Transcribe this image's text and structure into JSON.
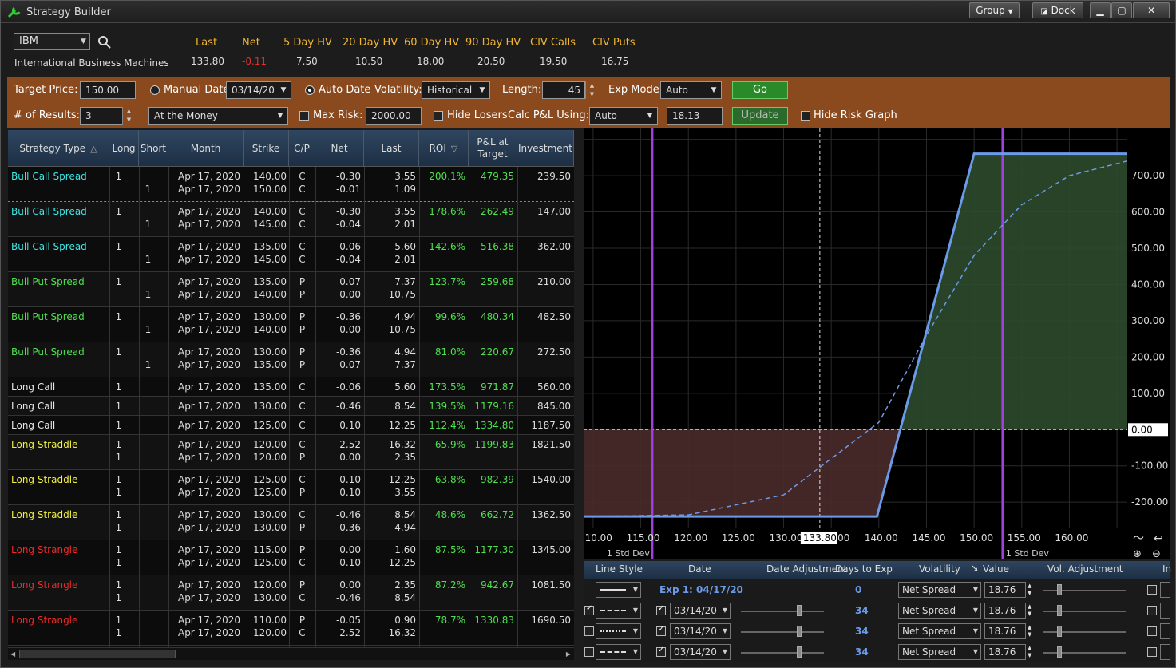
{
  "window": {
    "title": "Strategy Builder",
    "group_label": "Group",
    "dock_label": "Dock"
  },
  "quote": {
    "symbol": "IBM",
    "company": "International Business Machines",
    "headers": [
      "Last",
      "Net",
      "5 Day HV",
      "20 Day HV",
      "60 Day HV",
      "90 Day HV",
      "CIV Calls",
      "CIV Puts"
    ],
    "values": [
      "133.80",
      "-0.11",
      "7.50",
      "10.50",
      "18.00",
      "20.50",
      "19.50",
      "16.75"
    ]
  },
  "controls": {
    "target_price_label": "Target Price:",
    "target_price": "150.00",
    "manual_date_label": "Manual Date",
    "manual_date": "03/14/20",
    "auto_date_label": "Auto Date",
    "volatility_label": "Volatility:",
    "volatility": "Historical",
    "length_label": "Length:",
    "length": "45",
    "exp_mode_label": "Exp Mode:",
    "exp_mode": "Auto",
    "go_label": "Go",
    "results_label": "# of Results:",
    "results": "3",
    "moneyness": "At the Money",
    "max_risk_label": "Max Risk:",
    "max_risk": "2000.00",
    "hide_losers_label": "Hide Losers",
    "calc_pl_label": "Calc P&L Using:",
    "calc_pl": "Auto",
    "calc_value": "18.13",
    "update_label": "Update",
    "hide_risk_label": "Hide Risk Graph"
  },
  "table": {
    "headers": [
      "Strategy Type",
      "Long",
      "Short",
      "Month",
      "Strike",
      "C/P",
      "Net",
      "Last",
      "ROI",
      "P&L at Target",
      "Investment"
    ],
    "rows": [
      {
        "type": "Bull Call Spread",
        "color": "#3ee6e6",
        "legs": [
          [
            "1",
            "",
            "Apr 17, 2020",
            "140.00",
            "C",
            "-0.30",
            "3.55"
          ],
          [
            "",
            "1",
            "Apr 17, 2020",
            "150.00",
            "C",
            "-0.01",
            "1.09"
          ]
        ],
        "roi": "200.1%",
        "pl": "479.35",
        "inv": "239.50"
      },
      {
        "type": "Bull Call Spread",
        "color": "#3ee6e6",
        "legs": [
          [
            "1",
            "",
            "Apr 17, 2020",
            "140.00",
            "C",
            "-0.30",
            "3.55"
          ],
          [
            "",
            "1",
            "Apr 17, 2020",
            "145.00",
            "C",
            "-0.04",
            "2.01"
          ]
        ],
        "roi": "178.6%",
        "pl": "262.49",
        "inv": "147.00"
      },
      {
        "type": "Bull Call Spread",
        "color": "#3ee6e6",
        "legs": [
          [
            "1",
            "",
            "Apr 17, 2020",
            "135.00",
            "C",
            "-0.06",
            "5.60"
          ],
          [
            "",
            "1",
            "Apr 17, 2020",
            "145.00",
            "C",
            "-0.04",
            "2.01"
          ]
        ],
        "roi": "142.6%",
        "pl": "516.38",
        "inv": "362.00"
      },
      {
        "type": "Bull Put Spread",
        "color": "#4ee04e",
        "legs": [
          [
            "1",
            "",
            "Apr 17, 2020",
            "135.00",
            "P",
            "0.07",
            "7.37"
          ],
          [
            "",
            "1",
            "Apr 17, 2020",
            "140.00",
            "P",
            "0.00",
            "10.75"
          ]
        ],
        "roi": "123.7%",
        "pl": "259.68",
        "inv": "210.00"
      },
      {
        "type": "Bull Put Spread",
        "color": "#4ee04e",
        "legs": [
          [
            "1",
            "",
            "Apr 17, 2020",
            "130.00",
            "P",
            "-0.36",
            "4.94"
          ],
          [
            "",
            "1",
            "Apr 17, 2020",
            "140.00",
            "P",
            "0.00",
            "10.75"
          ]
        ],
        "roi": "99.6%",
        "pl": "480.34",
        "inv": "482.50"
      },
      {
        "type": "Bull Put Spread",
        "color": "#4ee04e",
        "legs": [
          [
            "1",
            "",
            "Apr 17, 2020",
            "130.00",
            "P",
            "-0.36",
            "4.94"
          ],
          [
            "",
            "1",
            "Apr 17, 2020",
            "135.00",
            "P",
            "0.07",
            "7.37"
          ]
        ],
        "roi": "81.0%",
        "pl": "220.67",
        "inv": "272.50"
      },
      {
        "type": "Long Call",
        "color": "#e8e8e8",
        "legs": [
          [
            "1",
            "",
            "Apr 17, 2020",
            "135.00",
            "C",
            "-0.06",
            "5.60"
          ]
        ],
        "roi": "173.5%",
        "pl": "971.87",
        "inv": "560.00"
      },
      {
        "type": "Long Call",
        "color": "#e8e8e8",
        "legs": [
          [
            "1",
            "",
            "Apr 17, 2020",
            "130.00",
            "C",
            "-0.46",
            "8.54"
          ]
        ],
        "roi": "139.5%",
        "pl": "1179.16",
        "inv": "845.00"
      },
      {
        "type": "Long Call",
        "color": "#e8e8e8",
        "legs": [
          [
            "1",
            "",
            "Apr 17, 2020",
            "125.00",
            "C",
            "0.10",
            "12.25"
          ]
        ],
        "roi": "112.4%",
        "pl": "1334.80",
        "inv": "1187.50"
      },
      {
        "type": "Long Straddle",
        "color": "#f0f040",
        "legs": [
          [
            "1",
            "",
            "Apr 17, 2020",
            "120.00",
            "C",
            "2.52",
            "16.32"
          ],
          [
            "1",
            "",
            "Apr 17, 2020",
            "120.00",
            "P",
            "0.00",
            "2.35"
          ]
        ],
        "roi": "65.9%",
        "pl": "1199.83",
        "inv": "1821.50"
      },
      {
        "type": "Long Straddle",
        "color": "#f0f040",
        "legs": [
          [
            "1",
            "",
            "Apr 17, 2020",
            "125.00",
            "C",
            "0.10",
            "12.25"
          ],
          [
            "1",
            "",
            "Apr 17, 2020",
            "125.00",
            "P",
            "0.10",
            "3.55"
          ]
        ],
        "roi": "63.8%",
        "pl": "982.39",
        "inv": "1540.00"
      },
      {
        "type": "Long Straddle",
        "color": "#f0f040",
        "legs": [
          [
            "1",
            "",
            "Apr 17, 2020",
            "130.00",
            "C",
            "-0.46",
            "8.54"
          ],
          [
            "1",
            "",
            "Apr 17, 2020",
            "130.00",
            "P",
            "-0.36",
            "4.94"
          ]
        ],
        "roi": "48.6%",
        "pl": "662.72",
        "inv": "1362.50"
      },
      {
        "type": "Long Strangle",
        "color": "#ee2a2a",
        "legs": [
          [
            "1",
            "",
            "Apr 17, 2020",
            "115.00",
            "P",
            "0.00",
            "1.60"
          ],
          [
            "1",
            "",
            "Apr 17, 2020",
            "125.00",
            "C",
            "0.10",
            "12.25"
          ]
        ],
        "roi": "87.5%",
        "pl": "1177.30",
        "inv": "1345.00"
      },
      {
        "type": "Long Strangle",
        "color": "#ee2a2a",
        "legs": [
          [
            "1",
            "",
            "Apr 17, 2020",
            "120.00",
            "P",
            "0.00",
            "2.35"
          ],
          [
            "1",
            "",
            "Apr 17, 2020",
            "130.00",
            "C",
            "-0.46",
            "8.54"
          ]
        ],
        "roi": "87.2%",
        "pl": "942.67",
        "inv": "1081.50"
      },
      {
        "type": "Long Strangle",
        "color": "#ee2a2a",
        "legs": [
          [
            "1",
            "",
            "Apr 17, 2020",
            "110.00",
            "P",
            "-0.05",
            "0.90"
          ],
          [
            "1",
            "",
            "Apr 17, 2020",
            "120.00",
            "C",
            "2.52",
            "16.32"
          ]
        ],
        "roi": "78.7%",
        "pl": "1330.83",
        "inv": "1690.50"
      }
    ]
  },
  "chart_data": {
    "type": "line",
    "x_ticks": [
      "110.00",
      "115.00",
      "120.00",
      "125.00",
      "130.00",
      "00",
      "140.00",
      "145.00",
      "150.00",
      "155.00",
      "160.00"
    ],
    "y_ticks": [
      "700.00",
      "600.00",
      "500.00",
      "400.00",
      "300.00",
      "200.00",
      "100.00",
      "0.00",
      "-100.00",
      "-200.00"
    ],
    "current_price": "133.80",
    "std_dev_label": "1 Std Dev",
    "xlim": [
      109,
      166
    ],
    "ylim": [
      -270,
      830
    ],
    "series": [
      {
        "x": [
          109,
          139.8,
          150,
          166
        ],
        "y": [
          -239.5,
          -239.5,
          760.5,
          760.5
        ]
      },
      {
        "x": [
          109,
          120,
          130,
          140,
          145,
          150,
          155,
          160,
          166
        ],
        "y": [
          -239.5,
          -235,
          -180,
          20,
          260,
          480,
          620,
          700,
          740
        ]
      }
    ],
    "std_dev_lines": [
      116.2,
      153.0
    ],
    "target_line": 133.8
  },
  "bottom_panel": {
    "headers": [
      "Line Style",
      "Date",
      "Date Adjustment",
      "Days to Exp",
      "Volatility",
      "Value",
      "Vol. Adjustment",
      "In"
    ],
    "exp_label": "Exp 1: 04/17/20",
    "rows": [
      {
        "date": "",
        "days": "0",
        "vol": "Net Spread",
        "value": "18.76"
      },
      {
        "date": "03/14/20",
        "days": "34",
        "vol": "Net Spread",
        "value": "18.76"
      },
      {
        "date": "03/14/20",
        "days": "34",
        "vol": "Net Spread",
        "value": "18.76"
      },
      {
        "date": "03/14/20",
        "days": "34",
        "vol": "Net Spread",
        "value": "18.76"
      }
    ]
  }
}
